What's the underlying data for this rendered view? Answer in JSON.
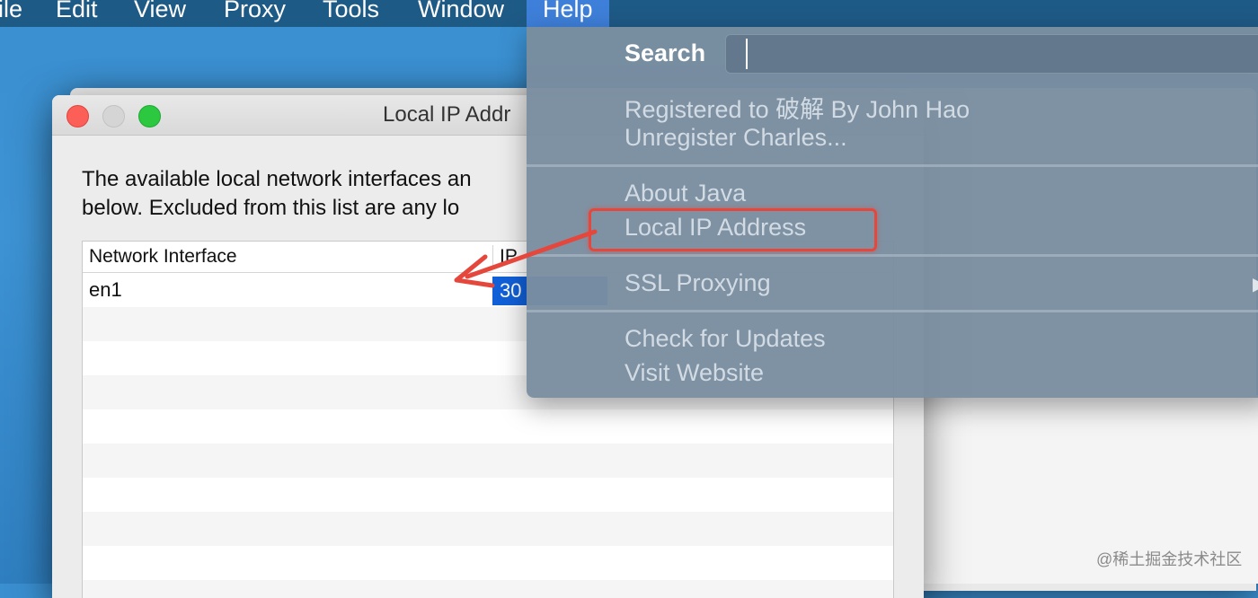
{
  "menubar": {
    "items": [
      "ile",
      "Edit",
      "View",
      "Proxy",
      "Tools",
      "Window",
      "Help"
    ],
    "active": "Help"
  },
  "dialog": {
    "title": "Local IP Addr",
    "description": "The available local network interfaces an\nbelow.  Excluded from this list are any lo",
    "table": {
      "headers": [
        "Network Interface",
        "IP"
      ],
      "rows": [
        {
          "interface": "en1",
          "ip": "30"
        }
      ]
    }
  },
  "help_menu": {
    "search_label": "Search",
    "search_value": "",
    "items": [
      "Registered to 破解 By John Hao",
      "Unregister Charles...",
      "About Java",
      "Local IP Address",
      "SSL Proxying",
      "Check for Updates",
      "Visit Website"
    ],
    "highlighted_item": "Local IP Address",
    "submenu_indicator": "▶"
  },
  "annotation": {
    "highlight_color": "#e5473c",
    "arrow_color": "#e5473c"
  },
  "watermark": "@稀土掘金技术社区"
}
